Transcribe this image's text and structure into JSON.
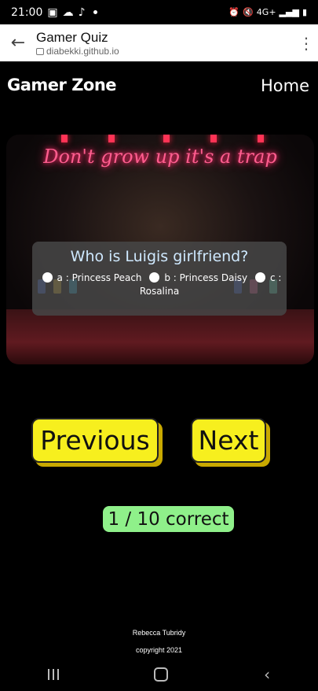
{
  "status_bar": {
    "time": "21:00",
    "network": "4G+"
  },
  "browser": {
    "title": "Gamer Quiz",
    "url": "diabekki.github.io"
  },
  "nav": {
    "brand": "Gamer Zone",
    "home": "Home"
  },
  "hero": {
    "neon_sign": "Don't grow up it's a trap"
  },
  "quiz": {
    "question": "Who is Luigis girlfriend?",
    "options": [
      "a : Princess Peach",
      "b : Princess Daisy",
      "c : Rosalina"
    ]
  },
  "buttons": {
    "previous": "Previous",
    "next": "Next"
  },
  "score": "1 / 10 correct",
  "footer": {
    "author": "Rebecca Tubridy",
    "copyright": "copyright 2021"
  },
  "colors": {
    "button_yellow": "#f7ef1e",
    "score_green": "#8ff08a",
    "question_text": "#cfe9ff"
  }
}
